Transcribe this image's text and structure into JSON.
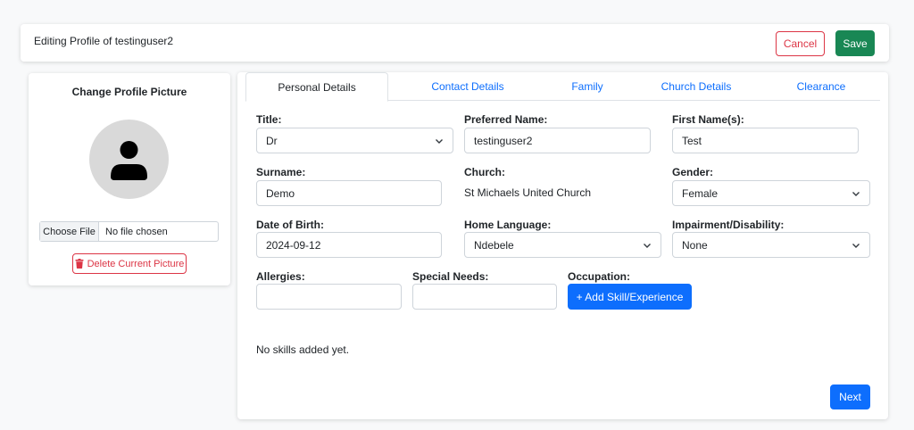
{
  "header": {
    "title": "Editing Profile of testinguser2",
    "cancel_label": "Cancel",
    "save_label": "Save"
  },
  "picture_panel": {
    "title": "Change Profile Picture",
    "choose_file_label": "Choose File",
    "file_status": "No file chosen",
    "delete_label": "Delete Current Picture"
  },
  "tabs": [
    {
      "label": "Personal Details",
      "active": true
    },
    {
      "label": "Contact Details",
      "active": false
    },
    {
      "label": "Family",
      "active": false
    },
    {
      "label": "Church Details",
      "active": false
    },
    {
      "label": "Clearance",
      "active": false
    }
  ],
  "form": {
    "title": {
      "label": "Title:",
      "value": "Dr"
    },
    "preferred_name": {
      "label": "Preferred Name:",
      "value": "testinguser2"
    },
    "first_names": {
      "label": "First Name(s):",
      "value": "Test"
    },
    "surname": {
      "label": "Surname:",
      "value": "Demo"
    },
    "church": {
      "label": "Church:",
      "value": "St Michaels United Church"
    },
    "gender": {
      "label": "Gender:",
      "value": "Female"
    },
    "dob": {
      "label": "Date of Birth:",
      "value": "2024-09-12"
    },
    "home_language": {
      "label": "Home Language:",
      "value": "Ndebele"
    },
    "impairment": {
      "label": "Impairment/Disability:",
      "value": "None"
    },
    "allergies": {
      "label": "Allergies:",
      "value": ""
    },
    "special_needs": {
      "label": "Special Needs:",
      "value": ""
    },
    "occupation": {
      "label": "Occupation:",
      "add_label": "+ Add Skill/Experience"
    },
    "no_skills_text": "No skills added yet.",
    "next_label": "Next"
  },
  "colors": {
    "primary": "#0d6efd",
    "success": "#198754",
    "danger": "#dc3545",
    "background": "#f8f9fa"
  },
  "icons": [
    "user-silhouette-icon",
    "trash-icon",
    "chevron-down-icon"
  ]
}
